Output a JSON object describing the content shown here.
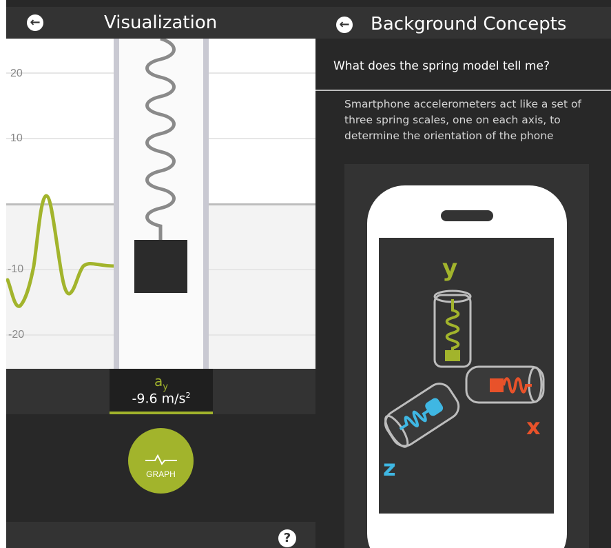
{
  "left_screen": {
    "title": "Visualization",
    "back_icon": "arrow-left-icon",
    "graph": {
      "tick_labels": [
        "20",
        "10",
        "-10",
        "-20"
      ],
      "trace_color": "#a2b42c"
    },
    "readout": {
      "symbol": "a",
      "axis": "y",
      "value": "-9.6 m/s",
      "exponent": "2"
    },
    "graph_button": {
      "label": "GRAPH",
      "icon": "heartbeat-icon"
    },
    "help_icon": "question-icon",
    "help_label": "?"
  },
  "right_screen": {
    "title": "Background Concepts",
    "back_icon": "arrow-left-icon",
    "question": "What does the spring model tell me?",
    "paragraph": "Smartphone accelerometers act like a set of three spring scales, one on each axis, to determine the orientation of the phone",
    "figure": {
      "axis_labels": {
        "y": "y",
        "x": "x",
        "z": "z"
      },
      "colors": {
        "y": "#a2b42c",
        "x": "#e8522a",
        "z": "#3fb7e3"
      }
    }
  }
}
